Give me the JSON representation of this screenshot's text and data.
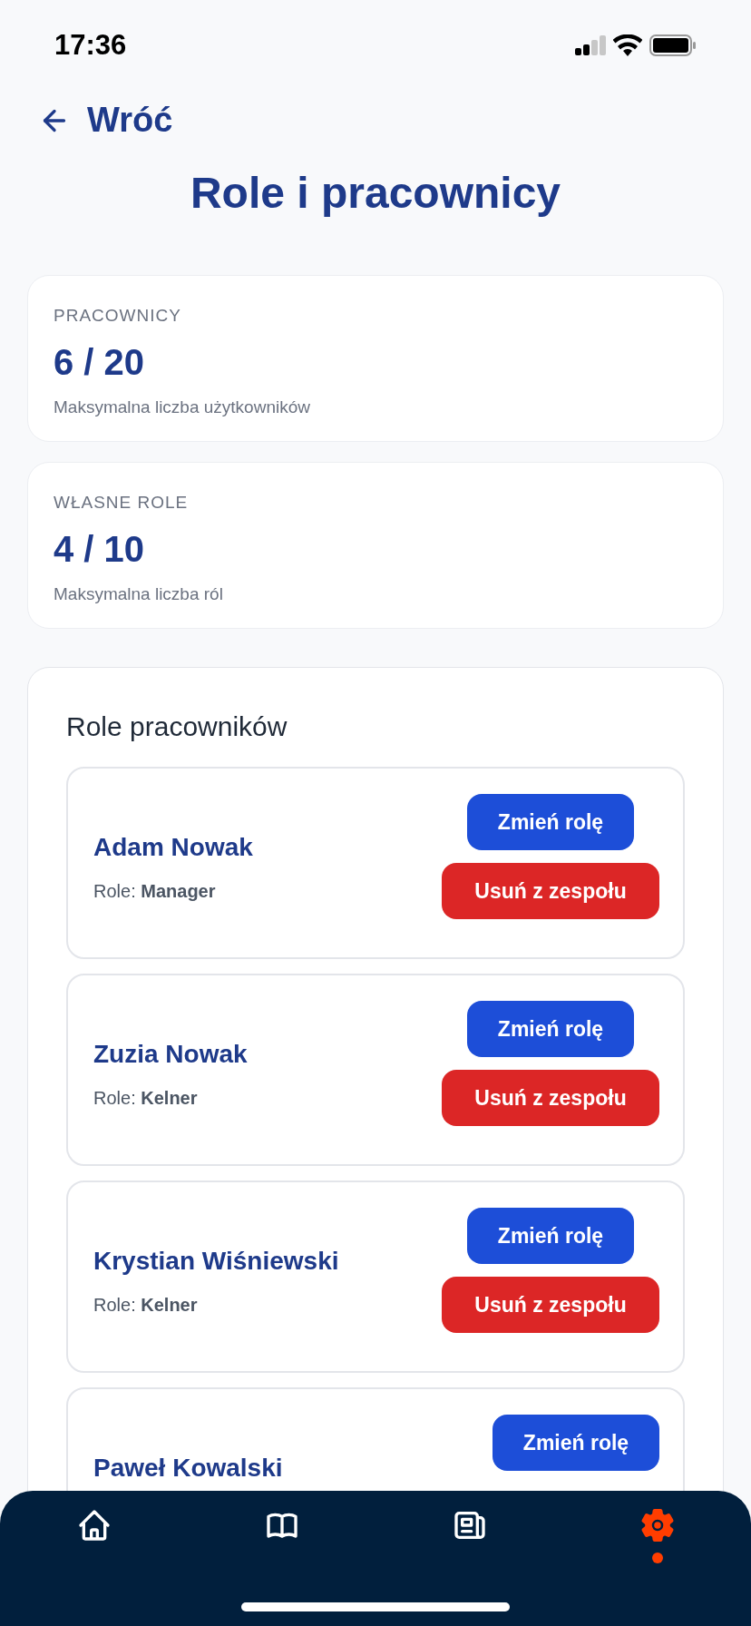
{
  "status_bar": {
    "time": "17:36"
  },
  "back": {
    "label": "Wróć"
  },
  "title": "Role i pracownicy",
  "stats": [
    {
      "label": "PRACOWNICY",
      "value": "6 / 20",
      "caption": "Maksymalna liczba użytkowników"
    },
    {
      "label": "WŁASNE ROLE",
      "value": "4 / 10",
      "caption": "Maksymalna liczba ról"
    }
  ],
  "employees_panel": {
    "heading": "Role pracowników",
    "employees": [
      {
        "name": "Adam Nowak",
        "role_label": "Role:",
        "role": "Manager",
        "change_button": "Zmień rolę",
        "remove_button": "Usuń z zespołu"
      },
      {
        "name": "Zuzia Nowak",
        "role_label": "Role:",
        "role": "Kelner",
        "change_button": "Zmień rolę",
        "remove_button": "Usuń z zespołu"
      },
      {
        "name": "Krystian Wiśniewski",
        "role_label": "Role:",
        "role": "Kelner",
        "change_button": "Zmień rolę",
        "remove_button": "Usuń z zespołu"
      },
      {
        "name": "Paweł Kowalski",
        "change_button": "Zmień rolę"
      }
    ]
  },
  "tab_bar": {
    "items": [
      {
        "kind": "home",
        "selected": false
      },
      {
        "kind": "book",
        "selected": false
      },
      {
        "kind": "news",
        "selected": false
      },
      {
        "kind": "settings",
        "selected": true
      }
    ]
  }
}
